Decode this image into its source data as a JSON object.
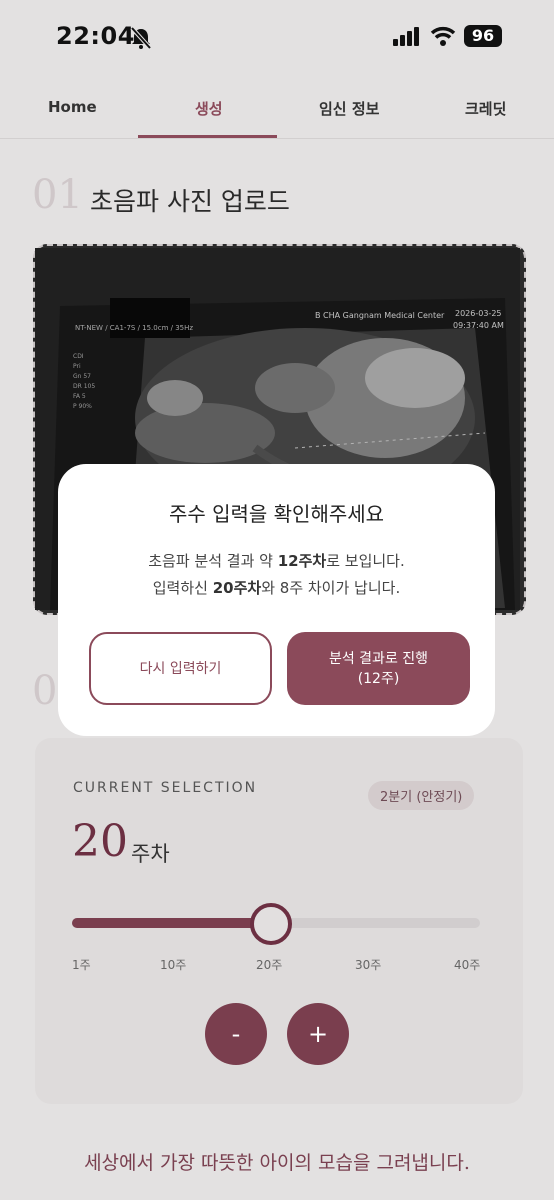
{
  "status_bar": {
    "time": "22:04",
    "battery": "96"
  },
  "tabs": [
    {
      "label": "Home"
    },
    {
      "label": "생성"
    },
    {
      "label": "임신 정보"
    },
    {
      "label": "크레딧"
    }
  ],
  "section1": {
    "number": "01",
    "title": "초음파 사진 업로드"
  },
  "photo": {
    "header_left": "NT-NEW / CA1-7S / 15.0cm / 35Hz",
    "header_right": "B CHA Gangnam Medical Center",
    "date": "2026-03-25",
    "time": "09:37:40 AM",
    "meas": [
      "CDI",
      "Pri",
      "Gn 57",
      "DR 105",
      "FA 5",
      "P 90%"
    ]
  },
  "section2": {
    "number": "0"
  },
  "selection": {
    "label": "CURRENT SELECTION",
    "trimester": "2분기 (안정기)",
    "week_value": "20",
    "week_unit": "주차",
    "slider_fraction": 0.4872,
    "ticks": [
      "1주",
      "10주",
      "20주",
      "30주",
      "40주"
    ],
    "minus": "-",
    "plus": "+"
  },
  "footer": "세상에서 가장 따뜻한 아이의 모습을 그려냅니다.",
  "modal": {
    "title": "주수 입력을 확인해주세요",
    "line1_pre": "초음파 분석 결과 약 ",
    "line1_bold": "12주차",
    "line1_post": "로 보입니다.",
    "line2_pre": "입력하신 ",
    "line2_bold": "20주차",
    "line2_post": "와 8주 차이가 납니다.",
    "retry_button": "다시 입력하기",
    "proceed_button_line1": "분석 결과로 진행",
    "proceed_button_line2": "(12주)"
  },
  "colors": {
    "accent": "#8b4a5a",
    "accent_dark": "#6c2f42"
  }
}
